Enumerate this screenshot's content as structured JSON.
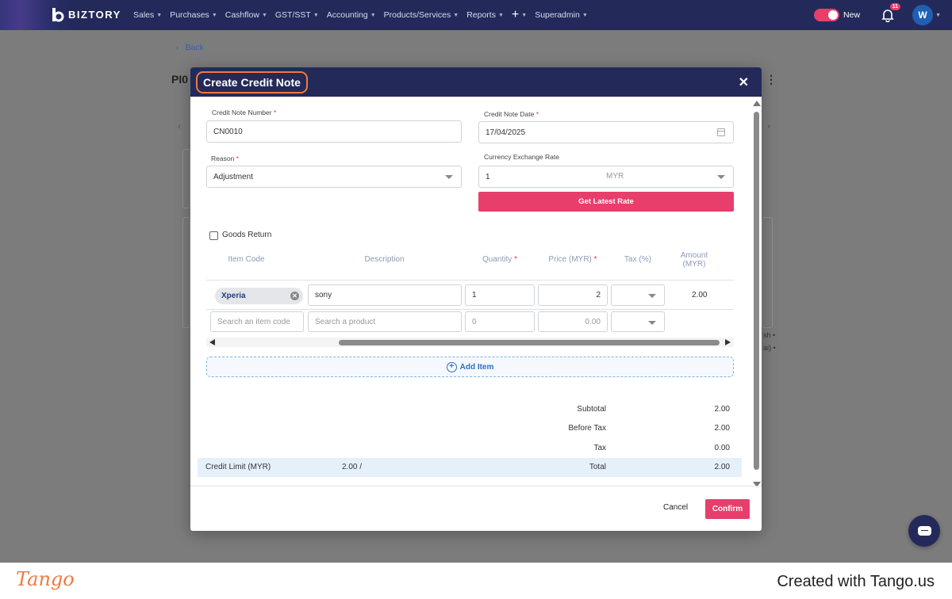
{
  "app": {
    "brand": "BIZTORY",
    "nav": [
      {
        "label": "Sales",
        "has_caret": true
      },
      {
        "label": "Purchases",
        "has_caret": true
      },
      {
        "label": "Cashflow",
        "has_caret": true
      },
      {
        "label": "GST/SST",
        "has_caret": true
      },
      {
        "label": "Accounting",
        "has_caret": true
      },
      {
        "label": "Products/Services",
        "has_caret": true
      },
      {
        "label": "Reports",
        "has_caret": true
      },
      {
        "label": "+",
        "has_caret": true
      },
      {
        "label": "Superadmin",
        "has_caret": true
      }
    ],
    "toggle_label": "New",
    "toggle_on": true,
    "notification_count": "11",
    "avatar_initial": "W",
    "accent_color": "#e83e6c",
    "nav_bg": "#232a5a"
  },
  "page": {
    "back_label": "Back",
    "title": "PI0",
    "side_snippets": [
      "sh •",
      "ai) •"
    ]
  },
  "modal": {
    "title": "Create Credit Note",
    "close_icon": "close-icon",
    "credit_note_number": {
      "label": "Credit Note Number",
      "required": "*",
      "value": "CN0010"
    },
    "credit_note_date": {
      "label": "Credit Note Date",
      "required": "*",
      "value": "17/04/2025"
    },
    "reason": {
      "label": "Reason",
      "required": "*",
      "value": "Adjustment"
    },
    "currency_exchange_rate": {
      "label": "Currency Exchange Rate",
      "value": "1",
      "currency": "MYR"
    },
    "get_latest_rate_label": "Get Latest Rate",
    "goods_return": {
      "label": "Goods Return",
      "checked": false
    },
    "table": {
      "headers": {
        "item_code": "Item Code",
        "description": "Description",
        "quantity": "Quantity",
        "price": "Price (MYR)",
        "tax": "Tax (%)",
        "amount_line1": "Amount",
        "amount_line2": "(MYR)"
      },
      "required_mark": "*",
      "rows": [
        {
          "item_code": "Xperia",
          "description": "sony",
          "quantity": "1",
          "price": "2",
          "tax": "",
          "amount": "2.00"
        }
      ],
      "new_row": {
        "item_code_placeholder": "Search an item code",
        "description_placeholder": "Search a product",
        "quantity_placeholder": "0",
        "price_placeholder": "0.00"
      }
    },
    "add_item_label": "Add Item",
    "summary": {
      "subtotal": {
        "label": "Subtotal",
        "value": "2.00"
      },
      "before_tax": {
        "label": "Before Tax",
        "value": "2.00"
      },
      "tax": {
        "label": "Tax",
        "value": "0.00"
      },
      "total": {
        "label": "Total",
        "value": "2.00"
      }
    },
    "credit_limit": {
      "label": "Credit Limit (MYR)",
      "value": "2.00 /"
    },
    "cancel_label": "Cancel",
    "confirm_label": "Confirm"
  },
  "footer": {
    "tango_logo": "Tango",
    "created_with": "Created with Tango.us"
  }
}
